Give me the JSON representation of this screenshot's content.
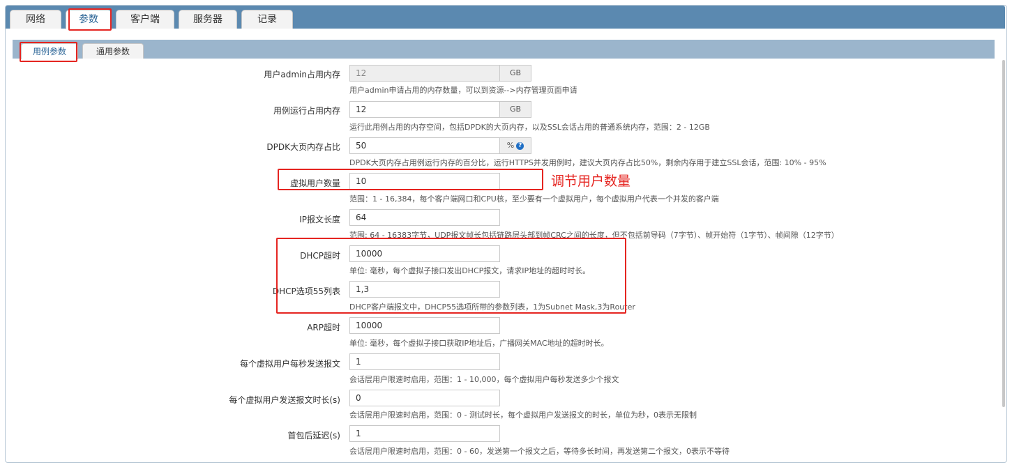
{
  "top_tabs": [
    {
      "label": "网络"
    },
    {
      "label": "参数"
    },
    {
      "label": "客户端"
    },
    {
      "label": "服务器"
    },
    {
      "label": "记录"
    }
  ],
  "active_top_tab": "参数",
  "sub_tabs": [
    {
      "label": "用例参数"
    },
    {
      "label": "通用参数"
    }
  ],
  "active_sub_tab": "用例参数",
  "fields": [
    {
      "label": "用户admin占用内存",
      "value": "12",
      "unit": "GB",
      "disabled": true,
      "hint": "用户admin申请占用的内存数量，可以到资源-->内存管理页面申请"
    },
    {
      "label": "用例运行占用内存",
      "value": "12",
      "unit": "GB",
      "hint": "运行此用例占用的内存空间，包括DPDK的大页内存，以及SSL会话占用的普通系统内存，范围：2 - 12GB"
    },
    {
      "label": "DPDK大页内存占比",
      "value": "50",
      "unit": "%",
      "hint": "DPDK大页内存占用例运行内存的百分比，运行HTTPS并发用例时，建议大页内存占比50%，剩余内存用于建立SSL会话，范围: 10% - 95%"
    },
    {
      "label": "虚拟用户数量",
      "value": "10",
      "hint": "范围：1 - 16,384，每个客户端网口和CPU核，至少要有一个虚拟用户，每个虚拟用户代表一个并发的客户端"
    },
    {
      "label": "IP报文长度",
      "value": "64",
      "hint": "范围: 64 - 16383字节，UDP报文帧长包括链路层头部到帧CRC之间的长度，但不包括前导码（7字节）、帧开始符（1字节）、帧间隙（12字节）"
    },
    {
      "label": "DHCP超时",
      "value": "10000",
      "hint": "单位: 毫秒，每个虚拟子接口发出DHCP报文，请求IP地址的超时时长。"
    },
    {
      "label": "DHCP选项55列表",
      "value": "1,3",
      "hint": "DHCP客户端报文中，DHCP55选项所带的参数列表，1为Subnet Mask,3为Router"
    },
    {
      "label": "ARP超时",
      "value": "10000",
      "hint": "单位: 毫秒，每个虚拟子接口获取IP地址后，广播网关MAC地址的超时时长。"
    },
    {
      "label": "每个虚拟用户每秒发送报文",
      "value": "1",
      "hint": "会话层用户限速时启用，范围：1 - 10,000，每个虚拟用户每秒发送多少个报文"
    },
    {
      "label": "每个虚拟用户发送报文时长(s)",
      "value": "0",
      "hint": "会话层用户限速时启用，范围：0 - 测试时长，每个虚拟用户发送报文的时长，单位为秒，0表示无限制"
    },
    {
      "label": "首包后延迟(s)",
      "value": "1",
      "hint": "会话层用户限速时启用，范围：0 - 60，发送第一个报文之后，等待多长时间，再发送第二个报文，0表示不等待"
    }
  ],
  "annotation": "调节用户数量",
  "colors": {
    "highlight": "#e52521",
    "topbar": "#5b89b0",
    "subbar": "#9bb5cc",
    "link": "#2a6496"
  },
  "icons": {
    "help": "question-circle-icon"
  }
}
